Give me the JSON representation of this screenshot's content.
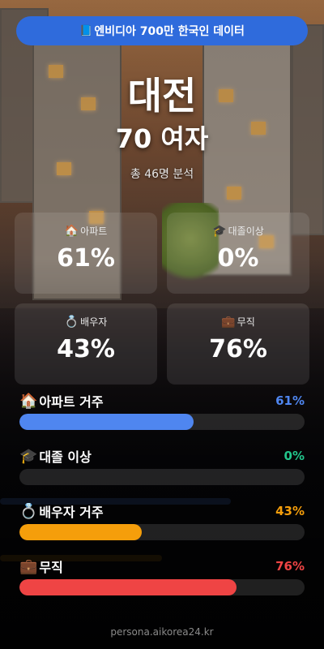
{
  "header": {
    "banner": "엔비디아 700만 한국인 데이터",
    "banner_icon": "book-icon"
  },
  "profile": {
    "city": "대전",
    "persona": "70 여자",
    "sample_count": "총 46명 분석"
  },
  "cards": [
    {
      "icon": "house-icon",
      "icon_glyph": "🏠",
      "label": "아파트",
      "value": "61%"
    },
    {
      "icon": "graduation-cap-icon",
      "icon_glyph": "🎓",
      "label": "대졸이상",
      "value": "0%"
    },
    {
      "icon": "ring-icon",
      "icon_glyph": "💍",
      "label": "배우자",
      "value": "43%"
    },
    {
      "icon": "briefcase-icon",
      "icon_glyph": "💼",
      "label": "무직",
      "value": "76%"
    }
  ],
  "stats": [
    {
      "icon": "house-icon",
      "icon_glyph": "🏠",
      "label": "아파트 거주",
      "percent_text": "61%",
      "value": 0.61,
      "color": "#4f86f0"
    },
    {
      "icon": "graduation-cap-icon",
      "icon_glyph": "🎓",
      "label": "대졸 이상",
      "percent_text": "0%",
      "value": 0.0,
      "color": "#22c58b"
    },
    {
      "icon": "ring-icon",
      "icon_glyph": "💍",
      "label": "배우자 거주",
      "percent_text": "43%",
      "value": 0.43,
      "color": "#f59e0b"
    },
    {
      "icon": "briefcase-icon",
      "icon_glyph": "💼",
      "label": "무직",
      "percent_text": "76%",
      "value": 0.76,
      "color": "#ef4444"
    }
  ],
  "footer": {
    "site": "persona.aikorea24.kr"
  }
}
